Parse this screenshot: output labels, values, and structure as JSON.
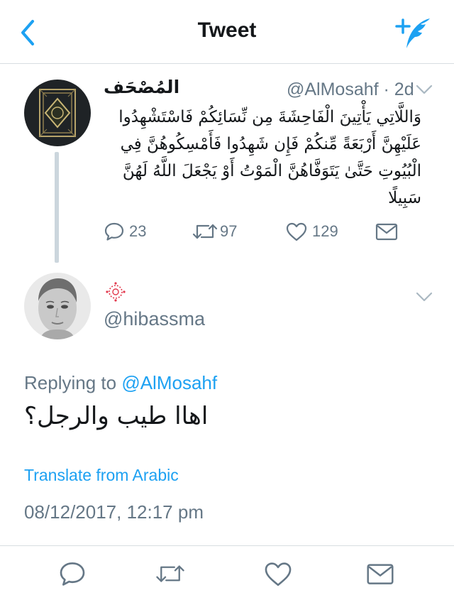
{
  "header": {
    "title": "Tweet",
    "back_icon": "chevron-left-icon",
    "compose_icon": "compose-tweet-icon",
    "accent_color": "#1da1f2"
  },
  "tweet1": {
    "display_name": "المُصْحَف",
    "handle_time": "@AlMosahf · 2d",
    "text": "وَاللَّاتِي يَأْتِينَ الْفَاحِشَةَ مِن نِّسَائِكُمْ فَاسْتَشْهِدُوا عَلَيْهِنَّ أَرْبَعَةً مِّنكُمْ فَإِن شَهِدُوا فَأَمْسِكُوهُنَّ فِي الْبُيُوتِ حَتَّىٰ يَتَوَفَّاهُنَّ الْمَوْتُ أَوْ يَجْعَلَ اللَّهُ لَهُنَّ سَبِيلًا",
    "actions": {
      "reply_count": "23",
      "retweet_count": "97",
      "like_count": "129"
    }
  },
  "tweet2": {
    "handle": "@hibassma",
    "replying_prefix": "Replying to",
    "replying_to": "@AlMosahf",
    "text": "اهاا طيب والرجل؟",
    "translate_label": "Translate from Arabic",
    "timestamp": "08/12/2017, 12:17 pm"
  },
  "colors": {
    "text_primary": "#14171a",
    "text_secondary": "#657786",
    "link": "#1da1f2",
    "border": "#d8dde1"
  }
}
